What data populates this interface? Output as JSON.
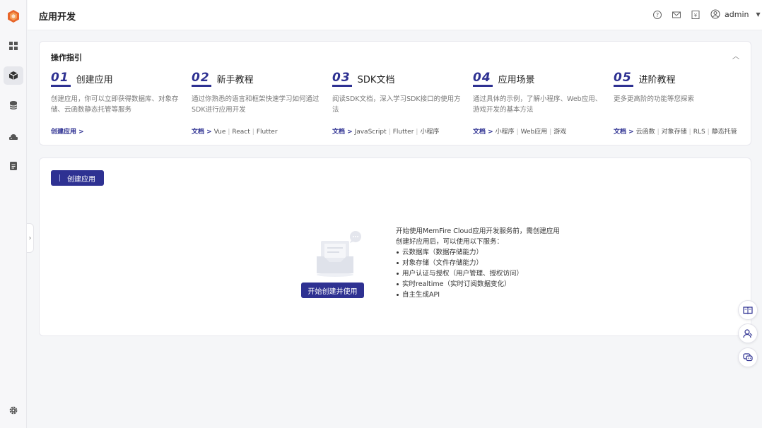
{
  "header": {
    "title": "应用开发",
    "user_name": "admin"
  },
  "guide": {
    "title": "操作指引",
    "steps": [
      {
        "num": "01",
        "name": "创建应用",
        "desc": "创建应用，你可以立即获得数据库、对象存储、云函数静态托管等服务",
        "lead": "创建应用 >",
        "links": []
      },
      {
        "num": "02",
        "name": "新手教程",
        "desc": "通过你熟悉的语言和框架快速学习如何通过SDK进行应用开发",
        "lead": "文档 >",
        "links": [
          "Vue",
          "React",
          "Flutter"
        ]
      },
      {
        "num": "03",
        "name": "SDK文档",
        "desc": "阅读SDK文档，深入学习SDK接口的使用方法",
        "lead": "文档 >",
        "links": [
          "JavaScript",
          "Flutter",
          "小程序"
        ]
      },
      {
        "num": "04",
        "name": "应用场景",
        "desc": "通过具体的示例，了解小程序、Web应用、游戏开发的基本方法",
        "lead": "文档 >",
        "links": [
          "小程序",
          "Web应用",
          "游戏"
        ]
      },
      {
        "num": "05",
        "name": "进阶教程",
        "desc": "更多更高阶的功能等您探索",
        "lead": "文档 >",
        "links": [
          "云函数",
          "对象存储",
          "RLS",
          "静态托管"
        ]
      }
    ]
  },
  "main": {
    "create_label": "创建应用",
    "start_label": "开始创建并使用",
    "intro_line1": "开始使用MemFire Cloud应用开发服务前，需创建应用",
    "intro_line2": "创建好应用后，可以使用以下服务：",
    "services": [
      "云数据库（数据存储能力）",
      "对象存储（文件存储能力）",
      "用户认证与授权（用户管理、授权访问）",
      "实时realtime（实时订阅数据变化）",
      "自主生成API"
    ]
  },
  "colors": {
    "brand": "#2e3192",
    "logo": "#e8662b"
  }
}
